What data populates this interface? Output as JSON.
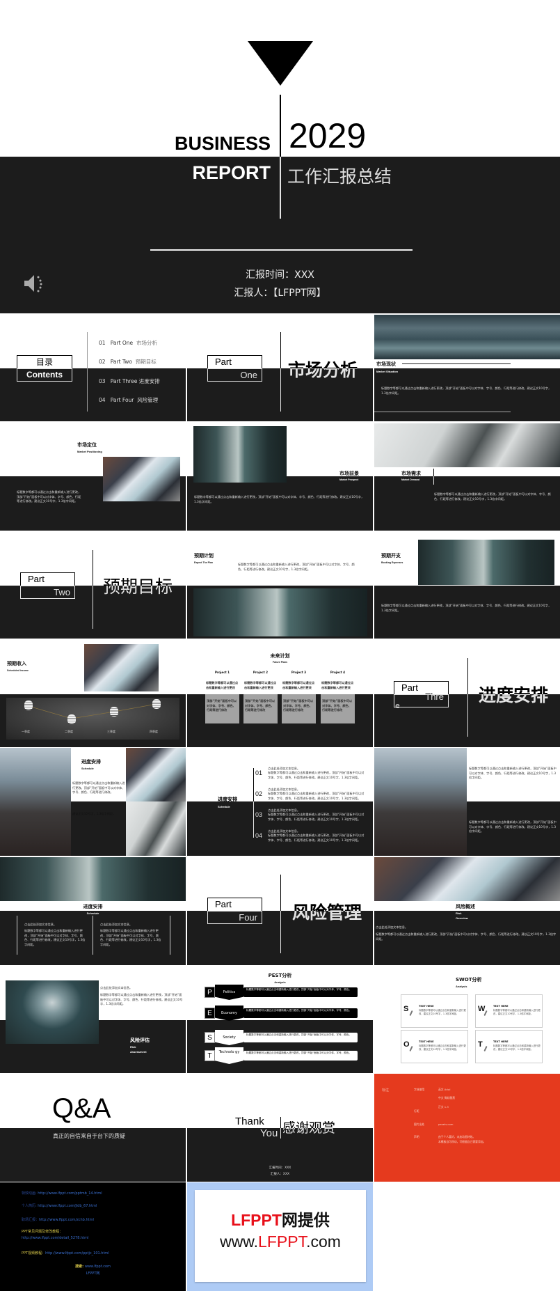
{
  "colors": {
    "dark": "#1c1c1c",
    "accent_red": "#e53a1e",
    "brand_red": "#e8101a",
    "link_blue": "#3a6fd0",
    "promo_bg": "#aecbf5"
  },
  "common": {
    "body": "标题数字等都可以通过点击和重新输入进行更改，顶部“开始”面板中可以对字体、字号、颜色、行距等进行修改。建议正文10号字，1.3倍字间距。",
    "body_a": "标题数字等都可以通过点击和重新输入进行更改，顶部“开始”面板中可以对字体、字号、颜色、行距等进行修改。",
    "body_b": "建议正文10号字，1.3倍字间距。",
    "click_add": "点击此处添加文本信息。"
  },
  "cover": {
    "en1": "BUSINESS",
    "en2": "REPORT",
    "year": "2029",
    "cn_title": "工作汇报总结",
    "time": "汇报时间：XXX",
    "reporter": "汇报人：【LFPPT网】",
    "audio_icon": "speaker-icon"
  },
  "contents": {
    "cn": "目录",
    "en": "Contents",
    "items": [
      {
        "num": "01",
        "en": "Part One",
        "cn": "市场分析"
      },
      {
        "num": "02",
        "en": "Part Two",
        "cn": "预期目标"
      },
      {
        "num": "03",
        "en": "Part Three",
        "cn": "进度安排"
      },
      {
        "num": "04",
        "en": "Part Four",
        "cn": "风险管理"
      }
    ]
  },
  "part1": {
    "part": "Part",
    "num": "One",
    "title": "市场分析"
  },
  "market_situation": {
    "cn": "市场现状",
    "en": "Market Situation"
  },
  "market_positioning": {
    "cn": "市场定位",
    "en": "Market Positioning"
  },
  "market_prospect": {
    "cn": "市场前景",
    "en": "Market Prospect"
  },
  "market_demand": {
    "cn": "市场需求",
    "en": "Market Demand"
  },
  "part2": {
    "part": "Part",
    "num": "Two",
    "title": "预期目标"
  },
  "expect_plan": {
    "cn": "预期计划",
    "en": "Expect The Plan"
  },
  "booking": {
    "cn": "预期开支",
    "en": "Booking Expenses"
  },
  "income": {
    "cn": "预期收入",
    "en": "Scheduled Income",
    "quarters": [
      "一季度",
      "二季度",
      "三季度",
      "四季度"
    ],
    "icon": "coin-stack-icon"
  },
  "future": {
    "cn": "未来计划",
    "en": "Future Plans",
    "projects": [
      "Project 1",
      "Project 2",
      "Project 3",
      "Project 4"
    ],
    "top_text": "标题数字等都可以通过点击和重新输入进行更改",
    "box_text": "顶部“开始”面板中可以对字体、字号、颜色、行距等进行修改"
  },
  "part3": {
    "part": "Part",
    "num": "Thre",
    "num_overflow": "e",
    "title": "进度安排"
  },
  "schedule": {
    "cn": "进度安排",
    "en": "Schedule",
    "nums": [
      "01",
      "02",
      "03",
      "04"
    ]
  },
  "part4": {
    "part": "Part",
    "num": "Four",
    "title": "风险管理"
  },
  "risk_overview": {
    "cn": "风险概述",
    "en1": "Risk",
    "en2": "Overview"
  },
  "risk_assess": {
    "cn": "风险评估",
    "en1": "Risk",
    "en2": "Assessment"
  },
  "pest": {
    "title": "PEST分析",
    "sub": "Analysis",
    "rows": [
      {
        "letter": "P",
        "label": "Politics"
      },
      {
        "letter": "E",
        "label": "Economy"
      },
      {
        "letter": "S",
        "label": "Society"
      },
      {
        "letter": "T",
        "label": "Technolo gy"
      }
    ],
    "text": "标题数字等都可以通过点击和重新输入进行更改，顶部“开始”面板中可以对字体、字号、颜色。"
  },
  "swot": {
    "title": "SWOT分析",
    "sub": "Analysis",
    "boxes": [
      {
        "letter": "S"
      },
      {
        "letter": "W"
      },
      {
        "letter": "O"
      },
      {
        "letter": "T"
      }
    ],
    "head": "TEXT HERE",
    "text": "标题数字等都可以通过点击和重新输入进行更改，建议正文10号字，1.3倍字间距。"
  },
  "qa": {
    "title": "Q&A",
    "sub": "真正的自信来自于台下的质疑"
  },
  "thanks": {
    "en1": "Thank",
    "en2": "You",
    "cn": "感谢观赏",
    "time": "汇报时间：XXX",
    "reporter": "汇报人：XXX"
  },
  "notes": {
    "label": "标注",
    "rows": [
      {
        "k": "字体使用",
        "v": "英文 Arial"
      },
      {
        "k": "",
        "v": "中文 微软雅黑"
      },
      {
        "k": "行距",
        "v": "正文 1.3"
      },
      {
        "k": "图片出处",
        "v": "pexels.com"
      },
      {
        "k": "声明",
        "v": "由于个人喜好，未加动画特效。"
      },
      {
        "k": "",
        "v": "本模板自可改动，可根据自己需要添加。"
      }
    ]
  },
  "links": {
    "items": [
      {
        "label": "特效动画: ",
        "url": "http://www.lfppt.com/pptmb_14.html"
      },
      {
        "label": "个人简历: ",
        "url": "http://www.lfppt.com/jldb_67.html"
      },
      {
        "label": "职场汇报：",
        "url": "http://www.lfppt.com/zchb.html"
      }
    ],
    "faq_label": "PPT常见问题及修改教程：",
    "faq_url": "http://www.lfppt.com/detail_5278.html",
    "video_label": "PPT视频教程：",
    "video_url": "http://www.lfppt.com/pptjc_101.html",
    "search_label": "搜索: ",
    "search_url": "www.lfppt.com",
    "brand": "LFPPT网"
  },
  "promo": {
    "line1_red": "LFPPT",
    "line1_black": "网提供",
    "line2_a": "www.",
    "line2_red": "LFPPT",
    "line2_b": ".com"
  }
}
